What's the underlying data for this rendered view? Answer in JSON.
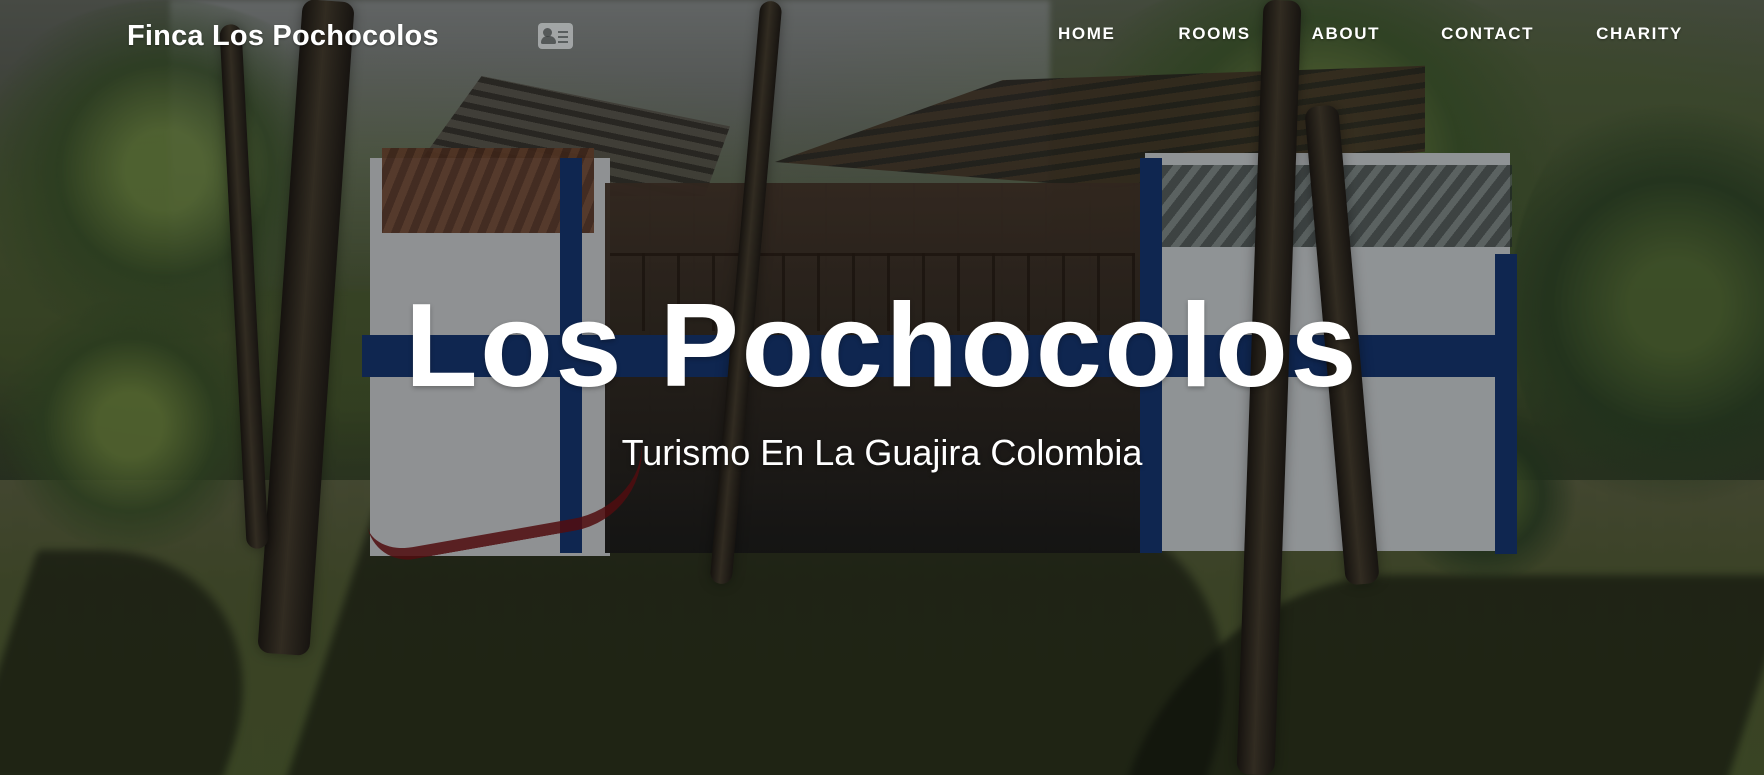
{
  "site": {
    "brand": "Finca Los Pochocolos",
    "brand_icon": "contact-card-icon"
  },
  "navigation": {
    "items": [
      {
        "label": "HOME"
      },
      {
        "label": "ROOMS"
      },
      {
        "label": "ABOUT"
      },
      {
        "label": "CONTACT"
      },
      {
        "label": "CHARITY"
      }
    ]
  },
  "hero": {
    "title": "Los Pochocolos",
    "subtitle": "Turismo En La Guajira Colombia",
    "background_subject": "house-with-trees-and-lawn",
    "text_color": "#ffffff",
    "accent_blue": "#173a7a"
  }
}
